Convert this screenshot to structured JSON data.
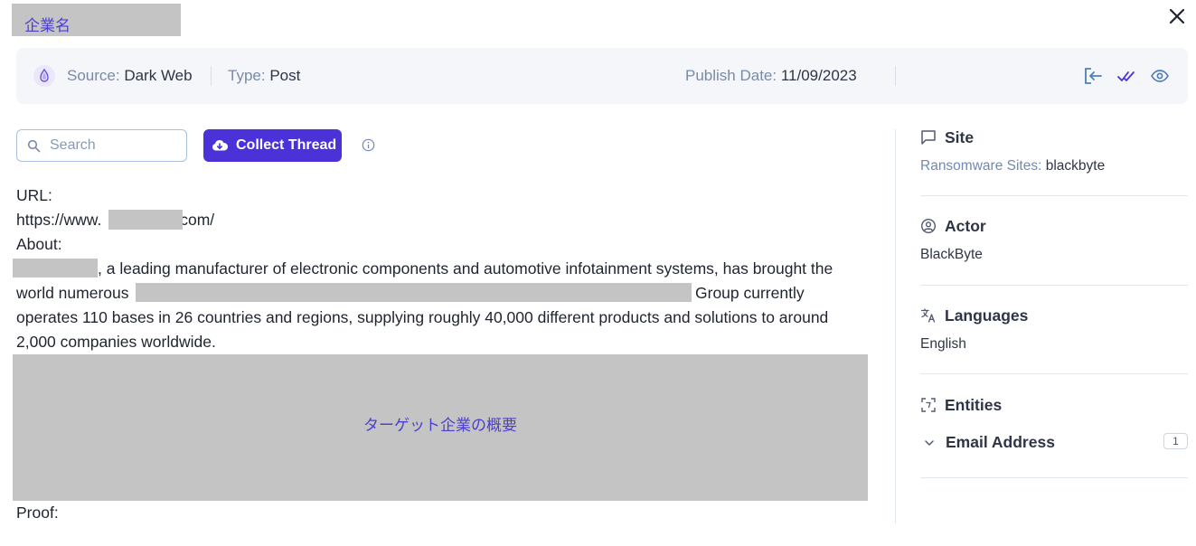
{
  "header": {
    "company_title": "企業名"
  },
  "meta": {
    "source_label": "Source:",
    "source_value": "Dark Web",
    "type_label": "Type:",
    "type_value": "Post",
    "publish_label": "Publish Date:",
    "publish_value": "11/09/2023",
    "icons": [
      "tor-onion-icon",
      "export-icon",
      "mark-read-icon",
      "view-icon"
    ]
  },
  "toolbar": {
    "search_placeholder": "Search",
    "collect_label": "Collect Thread"
  },
  "post": {
    "url_label": "URL:",
    "url_prefix": "https://www.",
    "url_suffix": ".com/",
    "about_label": "About:",
    "line1": ", a leading manufacturer of electronic components and automotive infotainment systems, has brought the",
    "line2_start": "world numerous",
    "line2_end": "Group currently",
    "line3": "operates 110 bases in 26 countries and regions, supplying roughly 40,000 different products and solutions to around",
    "line4": "2,000 companies worldwide.",
    "image_caption": "ターゲット企業の概要",
    "proof_label": "Proof:"
  },
  "sidebar": {
    "site": {
      "title": "Site",
      "label": "Ransomware Sites:",
      "value": "blackbyte"
    },
    "actor": {
      "title": "Actor",
      "value": "BlackByte"
    },
    "languages": {
      "title": "Languages",
      "value": "English"
    },
    "entities": {
      "title": "Entities",
      "item_label": "Email Address",
      "item_count": "1"
    }
  },
  "colors": {
    "accent": "#4a32d8",
    "muted_label": "#7a8aa5",
    "link_label": "#6f8bb3",
    "redaction": "#c4c4c4"
  }
}
